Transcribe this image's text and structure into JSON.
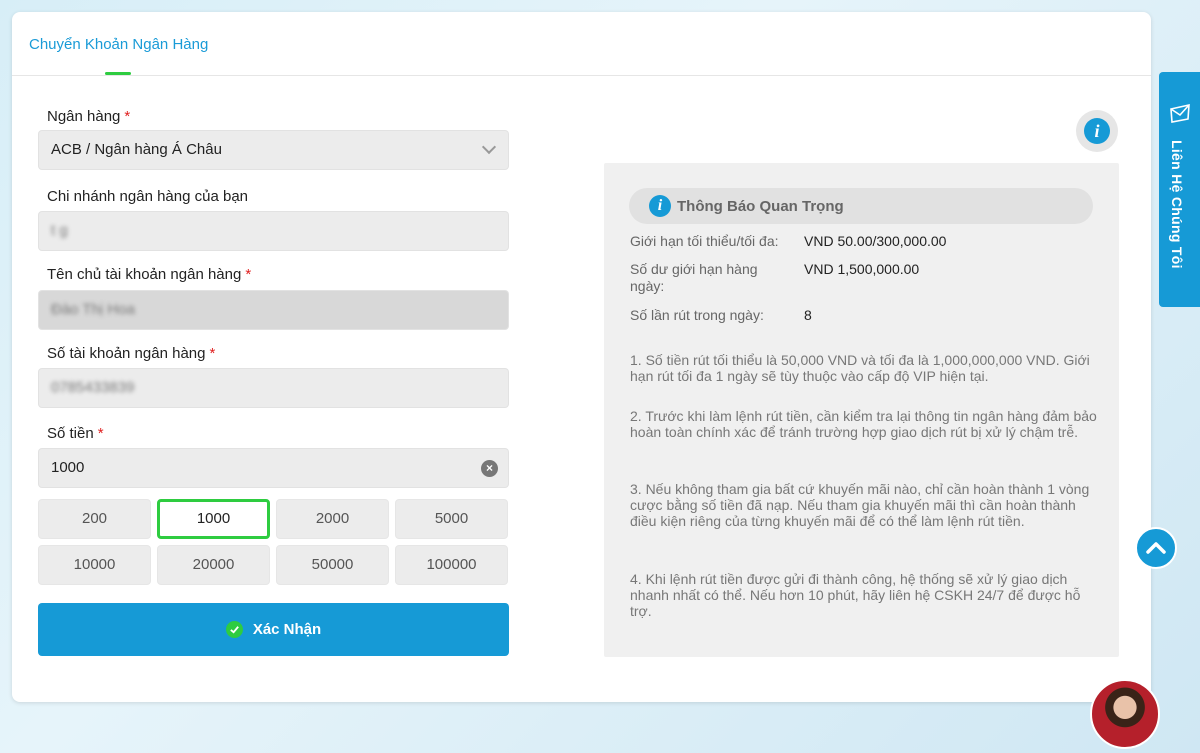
{
  "tab": {
    "label": "Chuyển Khoản Ngân Hàng"
  },
  "form": {
    "bank_label": "Ngân hàng",
    "bank_value": "ACB / Ngân hàng Á Châu",
    "branch_label": "Chi nhánh ngân hàng của bạn",
    "branch_value": "t                   g",
    "holder_label": "Tên chủ tài khoản ngân hàng",
    "holder_value": "Đào Thị Hoa",
    "account_label": "Số tài khoản ngân hàng",
    "account_value": "0785433839",
    "amount_label": "Số tiền",
    "amount_value": "1000",
    "required_mark": "*",
    "quick_amounts": [
      "200",
      "1000",
      "2000",
      "5000",
      "10000",
      "20000",
      "50000",
      "100000"
    ],
    "selected_amount": "1000",
    "confirm_label": "Xác Nhận"
  },
  "notice": {
    "title": "Thông Báo Quan Trọng",
    "limits": [
      {
        "label": "Giới hạn tối thiểu/tối đa:",
        "value": "VND 50.00/300,000.00"
      },
      {
        "label": "Số dư giới hạn hàng ngày:",
        "value": "VND 1,500,000.00"
      },
      {
        "label": "Số lần rút trong ngày:",
        "value": "8"
      }
    ],
    "notes": [
      "1. Số tiền rút tối thiểu là 50,000 VND và tối đa là 1,000,000,000 VND. Giới hạn rút tối đa 1 ngày sẽ tùy thuộc vào cấp độ VIP hiện tại.",
      "2. Trước khi làm lệnh rút tiền, cần kiểm tra lại thông tin ngân hàng đảm bảo hoàn toàn chính xác để tránh trường hợp giao dịch rút bị xử lý chậm trễ.",
      "3. Nếu không tham gia bất cứ khuyến mãi nào, chỉ cần hoàn thành 1 vòng cược bằng số tiền đã nạp. Nếu tham gia khuyến mãi thì cần hoàn thành điều kiện riêng của từng khuyến mãi để có thể làm lệnh rút tiền.",
      "4. Khi lệnh rút tiền được gửi đi thành công, hệ thống sẽ xử lý giao dịch nhanh nhất có thể. Nếu hơn 10 phút, hãy liên hệ CSKH 24/7 để được hỗ trợ."
    ]
  },
  "side": {
    "contact_label": "Liên Hệ Chúng Tôi"
  },
  "icons": {
    "info": "info-icon",
    "chevron": "chevron-down-icon",
    "clear": "clear-icon",
    "check": "check-circle-icon",
    "mail": "mail-icon",
    "scroll_top": "chevron-up-icon"
  },
  "colors": {
    "accent": "#169ad6",
    "success": "#2ecc40",
    "required": "#e02020"
  }
}
